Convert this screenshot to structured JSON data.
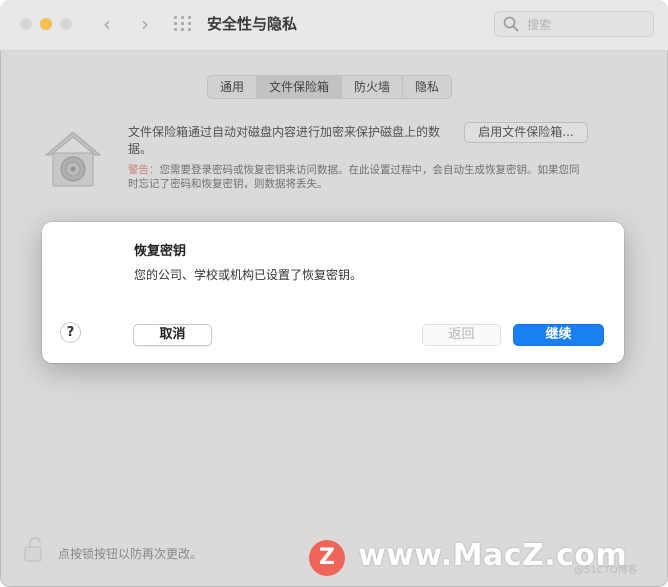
{
  "window": {
    "title": "安全性与隐私",
    "search_placeholder": "搜索"
  },
  "tabs": [
    {
      "label": "通用",
      "selected": false
    },
    {
      "label": "文件保险箱",
      "selected": true
    },
    {
      "label": "防火墙",
      "selected": false
    },
    {
      "label": "隐私",
      "selected": false
    }
  ],
  "filevault": {
    "description": "文件保险箱通过自动对磁盘内容进行加密来保护磁盘上的数据。",
    "enable_button": "启用文件保险箱...",
    "warning_label": "警告：",
    "warning_text": "您需要登录密码或恢复密钥来访问数据。在此设置过程中，会自动生成恢复密钥。如果您同时忘记了密码和恢复密钥，则数据将丢失。"
  },
  "dialog": {
    "title": "恢复密钥",
    "message": "您的公司、学校或机构已设置了恢复密钥。",
    "help_label": "?",
    "cancel_label": "取消",
    "back_label": "返回",
    "continue_label": "继续"
  },
  "footer": {
    "lock_text": "点按锁按钮以防再次更改。"
  },
  "watermark": {
    "logo_letter": "Z",
    "site": "www.MacZ.com",
    "small": "@51CTO博客"
  },
  "colors": {
    "accent": "#1a7ff0",
    "minimize": "#f5be4f",
    "warning": "#d98a7e"
  }
}
